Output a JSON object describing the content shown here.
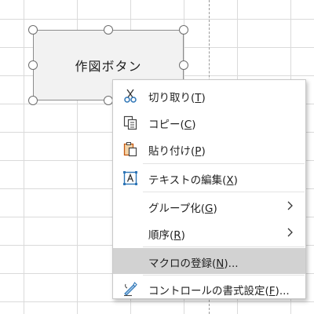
{
  "shape": {
    "label": "作図ボタン"
  },
  "context_menu": {
    "items": [
      {
        "text": "切り取り(",
        "key": "T",
        "close": ")",
        "icon": "scissors-icon"
      },
      {
        "text": "コピー(",
        "key": "C",
        "close": ")",
        "icon": "copy-icon"
      },
      {
        "text": "貼り付け(",
        "key": "P",
        "close": ")",
        "icon": "paste-icon"
      },
      {
        "text": "テキストの編集(",
        "key": "X",
        "close": ")",
        "icon": "edit-text-icon"
      },
      {
        "text": "グループ化(",
        "key": "G",
        "close": ")",
        "icon": "",
        "submenu": true
      },
      {
        "text": "順序(",
        "key": "R",
        "close": ")",
        "icon": "",
        "submenu": true
      },
      {
        "text": "マクロの登録(",
        "key": "N",
        "close": ")...",
        "icon": "",
        "highlighted": true
      },
      {
        "text": "コントロールの書式設定(",
        "key": "F",
        "close": ")...",
        "icon": "format-control-icon"
      }
    ]
  },
  "colors": {
    "menu_highlight": "#d2d2d2",
    "shape_fill": "#f2f2f2",
    "grid": "#dadada",
    "icon_blue": "#2e75b6",
    "icon_orange": "#c55a11"
  }
}
